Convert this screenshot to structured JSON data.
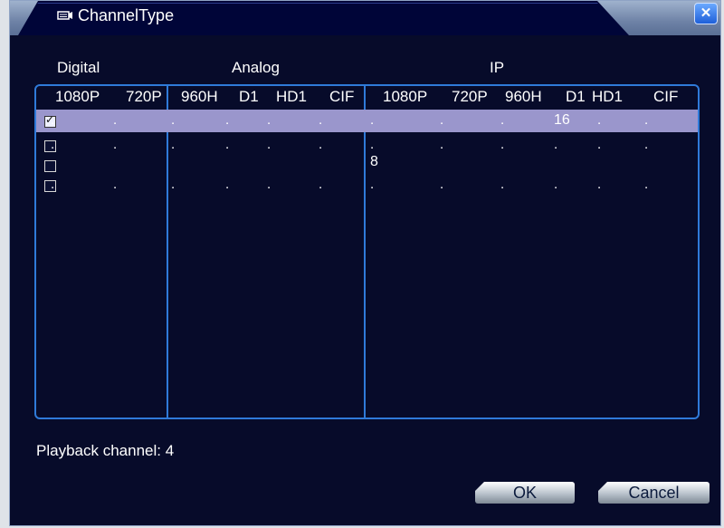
{
  "window": {
    "title": "ChannelType",
    "close_icon": "close-icon"
  },
  "groups": [
    "Digital",
    "Analog",
    "IP"
  ],
  "columns": [
    "1080P",
    "720P",
    "960H",
    "D1",
    "HD1",
    "CIF",
    "1080P",
    "720P",
    "960H",
    "D1",
    "HD1",
    "CIF"
  ],
  "rows": [
    {
      "checked": true,
      "values": [
        ".",
        ".",
        ".",
        ".",
        ".",
        ".",
        ".",
        ".",
        ".",
        "16",
        ".",
        "."
      ]
    },
    {
      "checked": false,
      "values": [
        ".",
        ".",
        ".",
        ".",
        ".",
        ".",
        ".",
        ".",
        ".",
        ".",
        ".",
        "."
      ]
    },
    {
      "checked": false,
      "values": [
        "",
        "",
        "",
        "",
        "",
        "",
        "8",
        "",
        "",
        "",
        "",
        ""
      ]
    },
    {
      "checked": false,
      "values": [
        ".",
        ".",
        ".",
        ".",
        ".",
        ".",
        ".",
        ".",
        ".",
        ".",
        ".",
        "."
      ]
    }
  ],
  "playback": "Playback channel: 4",
  "buttons": {
    "ok": "OK",
    "cancel": "Cancel"
  },
  "colors": {
    "background": "#070b2a",
    "accent": "#2f7ad9",
    "selected_row": "#9a96cc"
  }
}
